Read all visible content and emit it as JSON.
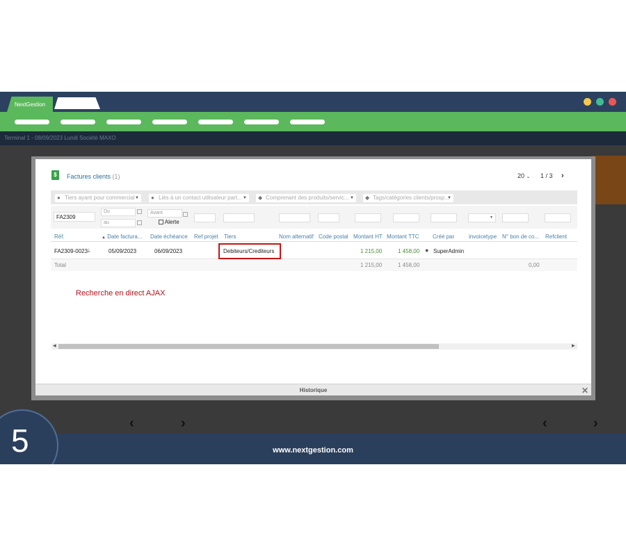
{
  "window": {
    "tab_label": "NextGestion"
  },
  "colors": {
    "accent": "#5cb85c",
    "frame": "#2a3f5c",
    "highlight": "#c81414",
    "dots": [
      "#f2c94c",
      "#3ebd93",
      "#eb5757"
    ]
  },
  "appbar": {
    "text": "Terminal 1 - 08/09/2023   Lundi   Société MAXO"
  },
  "modal": {
    "title": "Factures clients",
    "count": "(1)",
    "per_page": "20",
    "page_current": "1",
    "page_sep": "/",
    "page_total": "3",
    "filters": {
      "commercial": "Tiers ayant pour commercial",
      "contact": "Liés à un contact utilisateur part...",
      "products": "Comprenant des produits/servic...",
      "tags": "Tags/catégories clients/prosp..."
    },
    "search": {
      "ref_value": "FA2309",
      "du": "Du",
      "au": "au",
      "avant": "Avant",
      "alerte": "Alerte"
    },
    "columns": [
      "Réf.",
      "Date factura...",
      "Date échéance",
      "Ref projet",
      "Tiers",
      "Nom alternatif",
      "Code postal",
      "Montant HT",
      "Montant TTC",
      "Créé par",
      "invoicetype",
      "N° bon de co...",
      "Refclient"
    ],
    "row": {
      "ref": "FA2309-0023",
      "date_facture": "05/09/2023",
      "date_echeance": "06/09/2023",
      "tiers": "Debiteurs/Crediteurs",
      "montant_ht": "1 215,00",
      "montant_ttc": "1 458,00",
      "cree_par": "SuperAdmin"
    },
    "total": {
      "label": "Total",
      "ht": "1 215,00",
      "ttc": "1 458,00",
      "other": "0,00"
    },
    "annotation": "Recherche en direct AJAX",
    "footer": "Historique"
  },
  "bottom": {
    "url": "www.nextgestion.com",
    "step_number": "5"
  }
}
